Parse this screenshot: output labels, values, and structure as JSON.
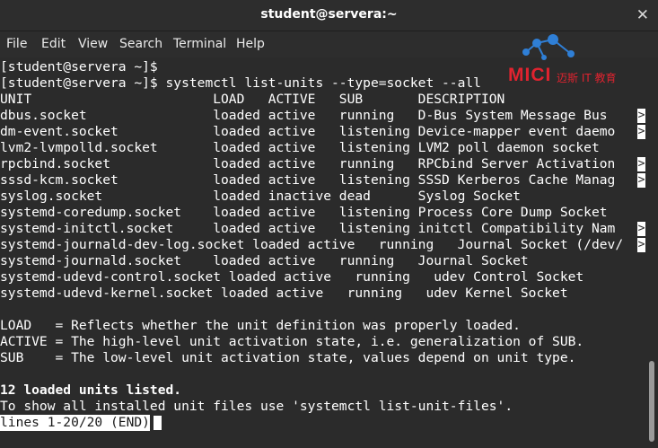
{
  "window": {
    "title": "student@servera:~",
    "close_icon": "close-icon"
  },
  "menu": [
    "File",
    "Edit",
    "View",
    "Search",
    "Terminal",
    "Help"
  ],
  "logo": {
    "brand": "MICI",
    "tagline": "迈斯 IT 教育",
    "color": "#e0232f"
  },
  "terminal": {
    "lines": [
      "[student@servera ~]$",
      "[student@servera ~]$ systemctl list-units --type=socket --all",
      "UNIT                       LOAD   ACTIVE   SUB       DESCRIPTION",
      "dbus.socket                loaded active   running   D-Bus System Message Bus",
      "dm-event.socket            loaded active   listening Device-mapper event daemo",
      "lvm2-lvmpolld.socket       loaded active   listening LVM2 poll daemon socket",
      "rpcbind.socket             loaded active   running   RPCbind Server Activation",
      "sssd-kcm.socket            loaded active   listening SSSD Kerberos Cache Manag",
      "syslog.socket              loaded inactive dead      Syslog Socket",
      "systemd-coredump.socket    loaded active   listening Process Core Dump Socket",
      "systemd-initctl.socket     loaded active   listening initctl Compatibility Nam",
      "systemd-journald-dev-log.socket loaded active   running   Journal Socket (/dev/",
      "systemd-journald.socket    loaded active   running   Journal Socket",
      "systemd-udevd-control.socket loaded active   running   udev Control Socket",
      "systemd-udevd-kernel.socket loaded active   running   udev Kernel Socket",
      "",
      "LOAD   = Reflects whether the unit definition was properly loaded.",
      "ACTIVE = The high-level unit activation state, i.e. generalization of SUB.",
      "SUB    = The low-level unit activation state, values depend on unit type.",
      "",
      "12 loaded units listed.",
      "To show all installed unit files use 'systemctl list-unit-files'."
    ],
    "truncation_marker": ">",
    "status_line": "lines 1-20/20 (END)"
  }
}
